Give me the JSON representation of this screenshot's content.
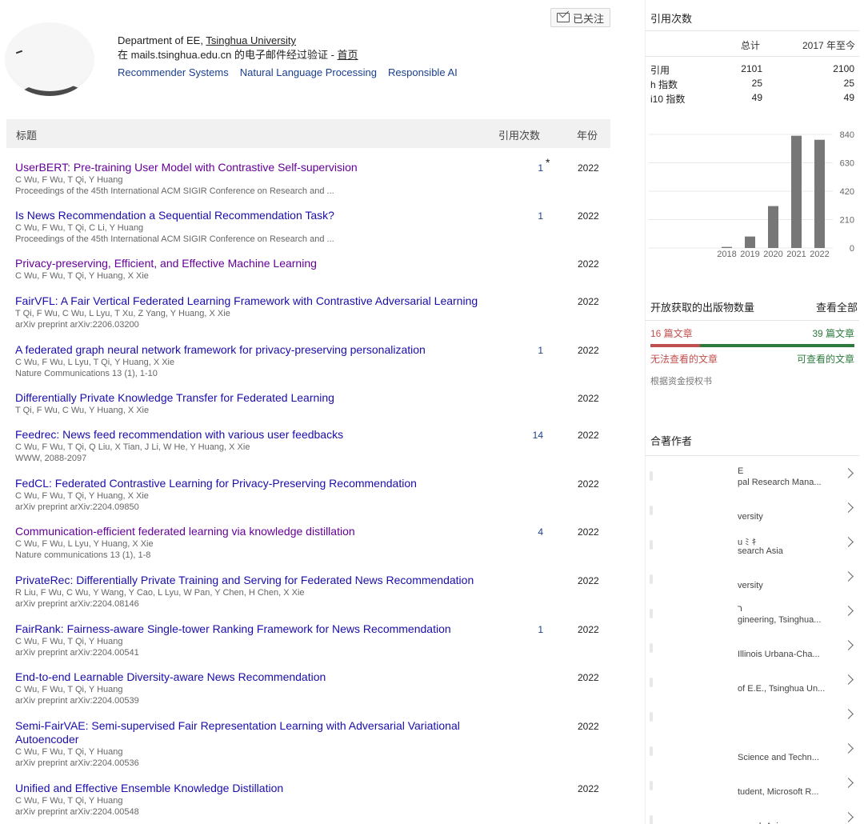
{
  "profile": {
    "follow_label": "已关注",
    "affiliation_prefix": "Department of EE, ",
    "affiliation_link": "Tsinghua University",
    "verified_text": "在 mails.tsinghua.edu.cn 的电子邮件经过验证 - ",
    "homepage_link": "首页",
    "interests": [
      "Recommender Systems",
      "Natural Language Processing",
      "Responsible AI"
    ]
  },
  "table": {
    "col_title": "标题",
    "col_cited": "引用次数",
    "col_year": "年份"
  },
  "articles": [
    {
      "title": "UserBERT: Pre-training User Model with Contrastive Self-supervision",
      "authors": "C Wu, F Wu, T Qi, Y Huang",
      "venue": "Proceedings of the 45th International ACM SIGIR Conference on Research and ...",
      "cited": "1",
      "star": "*",
      "year": "2022",
      "visited": true
    },
    {
      "title": "Is News Recommendation a Sequential Recommendation Task?",
      "authors": "C Wu, F Wu, T Qi, C Li, Y Huang",
      "venue": "Proceedings of the 45th International ACM SIGIR Conference on Research and ...",
      "cited": "1",
      "star": "",
      "year": "2022",
      "visited": false
    },
    {
      "title": "Privacy-preserving, Efficient, and Effective Machine Learning",
      "authors": "C Wu, F Wu, T Qi, Y Huang, X Xie",
      "venue": "",
      "cited": "",
      "star": "",
      "year": "2022",
      "visited": true
    },
    {
      "title": "FairVFL: A Fair Vertical Federated Learning Framework with Contrastive Adversarial Learning",
      "authors": "T Qi, F Wu, C Wu, L Lyu, T Xu, Z Yang, Y Huang, X Xie",
      "venue": "arXiv preprint arXiv:2206.03200",
      "cited": "",
      "star": "",
      "year": "2022",
      "visited": false
    },
    {
      "title": "A federated graph neural network framework for privacy-preserving personalization",
      "authors": "C Wu, F Wu, L Lyu, T Qi, Y Huang, X Xie",
      "venue": "Nature Communications 13 (1), 1-10",
      "cited": "1",
      "star": "",
      "year": "2022",
      "visited": false
    },
    {
      "title": "Differentially Private Knowledge Transfer for Federated Learning",
      "authors": "T Qi, F Wu, C Wu, Y Huang, X Xie",
      "venue": "",
      "cited": "",
      "star": "",
      "year": "2022",
      "visited": false
    },
    {
      "title": "Feedrec: News feed recommendation with various user feedbacks",
      "authors": "C Wu, F Wu, T Qi, Q Liu, X Tian, J Li, W He, Y Huang, X Xie",
      "venue": "WWW, 2088-2097",
      "cited": "14",
      "star": "",
      "year": "2022",
      "visited": false
    },
    {
      "title": "FedCL: Federated Contrastive Learning for Privacy-Preserving Recommendation",
      "authors": "C Wu, F Wu, T Qi, Y Huang, X Xie",
      "venue": "arXiv preprint arXiv:2204.09850",
      "cited": "",
      "star": "",
      "year": "2022",
      "visited": false
    },
    {
      "title": "Communication-efficient federated learning via knowledge distillation",
      "authors": "C Wu, F Wu, L Lyu, Y Huang, X Xie",
      "venue": "Nature communications 13 (1), 1-8",
      "cited": "4",
      "star": "",
      "year": "2022",
      "visited": true
    },
    {
      "title": "PrivateRec: Differentially Private Training and Serving for Federated News Recommendation",
      "authors": "R Liu, F Wu, C Wu, Y Wang, Y Cao, L Lyu, W Pan, Y Chen, H Chen, X Xie",
      "venue": "arXiv preprint arXiv:2204.08146",
      "cited": "",
      "star": "",
      "year": "2022",
      "visited": false
    },
    {
      "title": "FairRank: Fairness-aware Single-tower Ranking Framework for News Recommendation",
      "authors": "C Wu, F Wu, T Qi, Y Huang",
      "venue": "arXiv preprint arXiv:2204.00541",
      "cited": "1",
      "star": "",
      "year": "2022",
      "visited": false
    },
    {
      "title": "End-to-end Learnable Diversity-aware News Recommendation",
      "authors": "C Wu, F Wu, T Qi, Y Huang",
      "venue": "arXiv preprint arXiv:2204.00539",
      "cited": "",
      "star": "",
      "year": "2022",
      "visited": false
    },
    {
      "title": "Semi-FairVAE: Semi-supervised Fair Representation Learning with Adversarial Variational Autoencoder",
      "authors": "C Wu, F Wu, T Qi, Y Huang",
      "venue": "arXiv preprint arXiv:2204.00536",
      "cited": "",
      "star": "",
      "year": "2022",
      "visited": false
    },
    {
      "title": "Unified and Effective Ensemble Knowledge Distillation",
      "authors": "C Wu, F Wu, T Qi, Y Huang",
      "venue": "arXiv preprint arXiv:2204.00548",
      "cited": "",
      "star": "",
      "year": "2022",
      "visited": false
    }
  ],
  "citations": {
    "title": "引用次数",
    "col_all": "总计",
    "col_since": "2017 年至今",
    "rows": [
      {
        "label": "引用",
        "all": "2101",
        "since": "2100"
      },
      {
        "label": "h 指数",
        "all": "25",
        "since": "25"
      },
      {
        "label": "i10 指数",
        "all": "49",
        "since": "49"
      }
    ]
  },
  "chart_data": {
    "type": "bar",
    "categories": [
      "2018",
      "2019",
      "2020",
      "2021",
      "2022"
    ],
    "values": [
      8,
      85,
      310,
      830,
      800
    ],
    "ylim": [
      0,
      840
    ],
    "yticks": [
      "0",
      "210",
      "420",
      "630",
      "840"
    ],
    "bar_color": "#777777"
  },
  "open_access": {
    "title": "开放获取的出版物数量",
    "view_all": "查看全部",
    "unavailable_count": "16 篇文章",
    "available_count": "39 篇文章",
    "unavailable_label": "无法查看的文章",
    "available_label": "可查看的文章",
    "mandates": "根据资金授权书",
    "unavailable_color": "#c0504d",
    "available_color": "#2d7a3e"
  },
  "coauthors": {
    "title": "合著作者",
    "items": [
      {
        "l1": "E",
        "l2": "pal Research Mana..."
      },
      {
        "l1": "",
        "l2": "versity"
      },
      {
        "l1": "u ﾐ   ｷ",
        "l2": "search Asia"
      },
      {
        "l1": "",
        "l2": "versity"
      },
      {
        "l1": "ר",
        "l2": "gineering, Tsinghua..."
      },
      {
        "l1": "",
        "l2": "Illinois Urbana-Cha..."
      },
      {
        "l1": "",
        "l2": "of E.E., Tsinghua Un..."
      },
      {
        "l1": "",
        "l2": ""
      },
      {
        "l1": "",
        "l2": "Science and Techn..."
      },
      {
        "l1": "",
        "l2": "tudent, Microsoft R..."
      },
      {
        "l1": "",
        "l2": "search Asia"
      }
    ]
  }
}
